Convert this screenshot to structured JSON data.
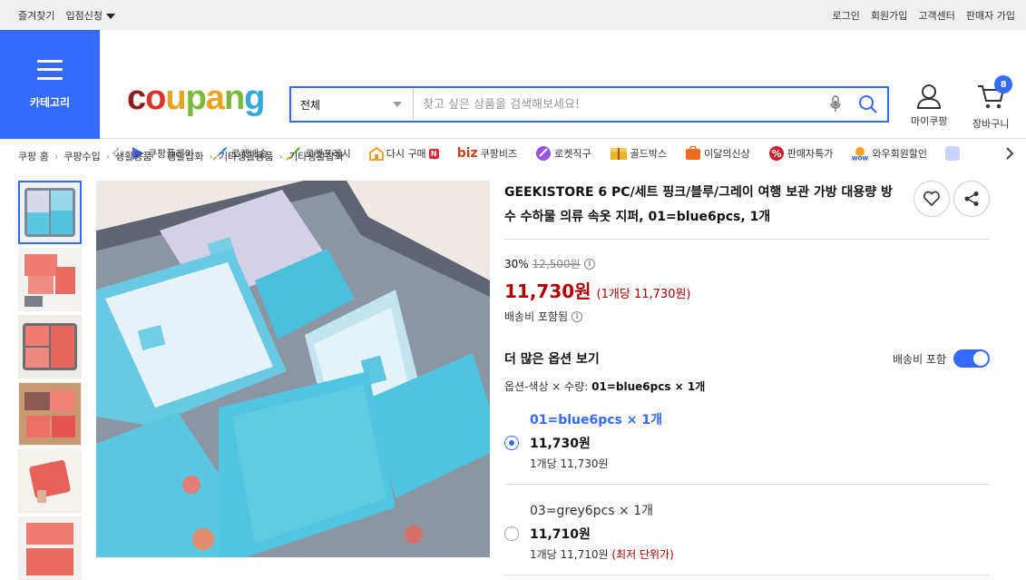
{
  "topbar": {
    "left": [
      "즐겨찾기",
      "입점신청"
    ],
    "right": [
      "로그인",
      "회원가입",
      "고객센터",
      "판매자 가입"
    ]
  },
  "header": {
    "category_label": "카테고리",
    "logo": "coupang",
    "search": {
      "category_value": "전체",
      "placeholder": "찾고 싶은 상품을 검색해보세요!"
    },
    "mypage_label": "마이쿠팡",
    "cart_label": "장바구니",
    "cart_count": "8",
    "nav": [
      {
        "label": "쿠팡플레이",
        "icon": "play-icon",
        "color": "#4b6cf7"
      },
      {
        "label": "로켓배송",
        "icon": "rocket-icon",
        "color": "#3a86e8"
      },
      {
        "label": "로켓프레시",
        "icon": "rocket-fresh-icon",
        "color": "#5bb632"
      },
      {
        "label": "다시 구매",
        "icon": "rebuy-icon",
        "color": "#f29a1d",
        "badge": "N"
      },
      {
        "label": "쿠팡비즈",
        "icon": "biz-icon",
        "color": "#d24a2a",
        "prefix": "biz"
      },
      {
        "label": "로켓직구",
        "icon": "global-icon",
        "color": "#9b52e0"
      },
      {
        "label": "골드박스",
        "icon": "goldbox-icon",
        "color": "#e5b62a"
      },
      {
        "label": "이달의신상",
        "icon": "new-icon",
        "color": "#f06b22"
      },
      {
        "label": "판매자특가",
        "icon": "percent-icon",
        "color": "#c8202e"
      },
      {
        "label": "와우회원할인",
        "icon": "wow-icon",
        "color": "#1c4fc1"
      }
    ]
  },
  "breadcrumb": [
    "쿠팡 홈",
    "쿠팡수입",
    "생활용품",
    "생활잡화",
    "기타생활용품",
    "기타생활잡화"
  ],
  "product": {
    "title": "GEEKISTORE 6 PC/세트 핑크/블루/그레이 여행 보관 가방 대용량 방수 수하물 의류 속옷 지퍼, 01=blue6pcs, 1개",
    "discount_rate": "30%",
    "original_price": "12,500원",
    "price": "11,730원",
    "unit_price": "(1개당 11,730원)",
    "shipping": "배송비 포함됨",
    "more_options_title": "더 많은 옵션 보기",
    "shipping_toggle_label": "배송비 포함",
    "option_selected_label": "옵션-색상 × 수량:",
    "option_selected_value": "01=blue6pcs × 1개",
    "options": [
      {
        "name": "01=blue6pcs × 1개",
        "price": "11,730원",
        "unit": "1개당 11,730원",
        "best": ""
      },
      {
        "name": "03=grey6pcs × 1개",
        "price": "11,710원",
        "unit": "1개당 11,710원",
        "best": "(최저 단위가)"
      }
    ]
  }
}
